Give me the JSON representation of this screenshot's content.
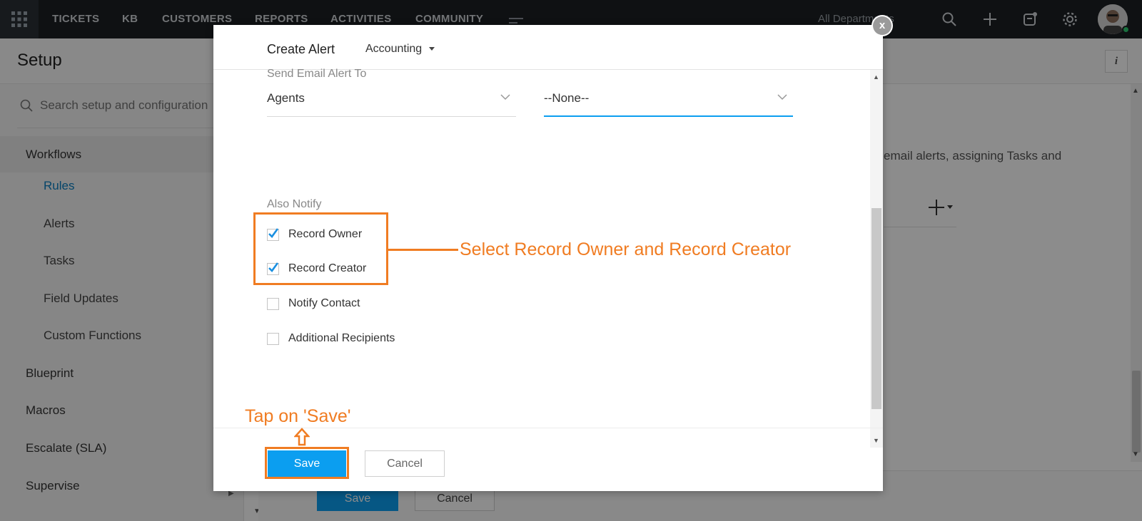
{
  "topbar": {
    "nav": [
      "TICKETS",
      "KB",
      "CUSTOMERS",
      "REPORTS",
      "ACTIVITIES",
      "COMMUNITY"
    ],
    "department": "All Departments"
  },
  "setup": {
    "title": "Setup"
  },
  "sidebar": {
    "search_placeholder": "Search setup and configuration",
    "groups": {
      "workflows": "Workflows",
      "blueprint": "Blueprint",
      "macros": "Macros",
      "escalate": "Escalate (SLA)",
      "supervise": "Supervise"
    },
    "sub_items": [
      "Rules",
      "Alerts",
      "Tasks",
      "Field Updates",
      "Custom Functions"
    ]
  },
  "main": {
    "description": "email alerts, assigning Tasks and",
    "save_label": "Save",
    "cancel_label": "Cancel"
  },
  "modal": {
    "title": "Create Alert",
    "department": "Accounting",
    "send_email_label": "Send Email Alert To",
    "recipient_type": "Agents",
    "recipient_value": "--None--",
    "also_notify_label": "Also Notify",
    "checkboxes": [
      {
        "label": "Record Owner",
        "checked": true
      },
      {
        "label": "Record Creator",
        "checked": true
      },
      {
        "label": "Notify Contact",
        "checked": false
      },
      {
        "label": "Additional Recipients",
        "checked": false
      }
    ],
    "save_label": "Save",
    "cancel_label": "Cancel",
    "close_label": "x"
  },
  "annotations": {
    "select_text": "Select Record Owner and Record Creator",
    "tap_text": "Tap on 'Save'",
    "color": "#f07c22"
  },
  "colors": {
    "accent": "#0b9ef0",
    "topbar": "#1c2024",
    "annotation": "#f07c22"
  }
}
